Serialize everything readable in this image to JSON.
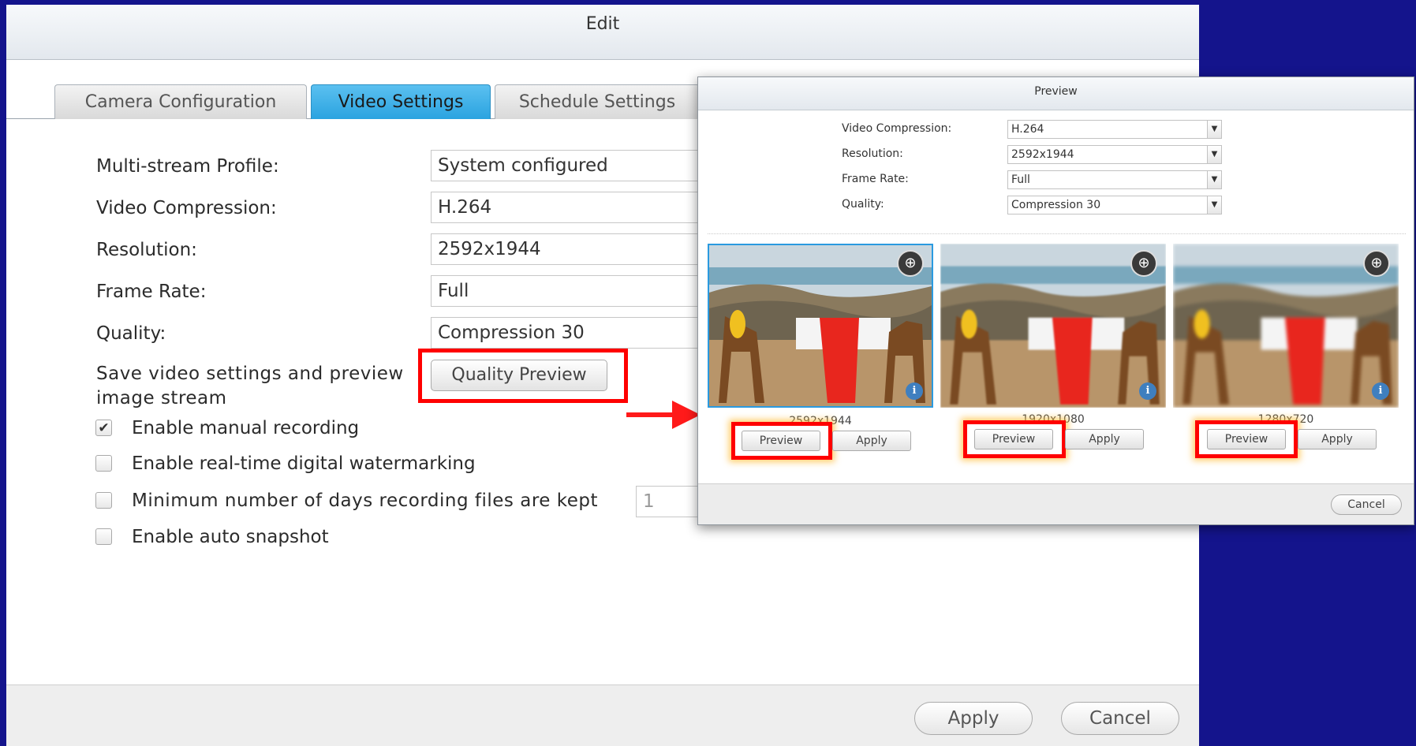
{
  "edit_dialog": {
    "title": "Edit",
    "tabs": [
      {
        "label": "Camera Configuration",
        "active": false
      },
      {
        "label": "Video Settings",
        "active": true
      },
      {
        "label": "Schedule Settings",
        "active": false
      }
    ],
    "fields": {
      "multi_stream_profile": {
        "label": "Multi-stream Profile:",
        "value": "System configured"
      },
      "video_compression": {
        "label": "Video Compression:",
        "value": "H.264"
      },
      "resolution": {
        "label": "Resolution:",
        "value": "2592x1944"
      },
      "frame_rate": {
        "label": "Frame Rate:",
        "value": "Full"
      },
      "quality": {
        "label": "Quality:",
        "value": "Compression 30"
      }
    },
    "save_preview_text_line1": "Save video settings and preview",
    "save_preview_text_line2": "image stream",
    "quality_preview_button": "Quality Preview",
    "checkboxes": [
      {
        "label": "Enable manual recording",
        "checked": true,
        "mark": "✔"
      },
      {
        "label": "Enable real-time digital watermarking",
        "checked": false,
        "mark": ""
      },
      {
        "label": "Minimum number of days recording files are kept",
        "checked": false,
        "mark": "",
        "input_value": "1"
      },
      {
        "label": "Enable auto snapshot",
        "checked": false,
        "mark": ""
      }
    ],
    "footer": {
      "apply": "Apply",
      "cancel": "Cancel"
    }
  },
  "preview_dialog": {
    "title": "Preview",
    "fields": {
      "video_compression": {
        "label": "Video Compression:",
        "value": "H.264"
      },
      "resolution": {
        "label": "Resolution:",
        "value": "2592x1944"
      },
      "frame_rate": {
        "label": "Frame Rate:",
        "value": "Full"
      },
      "quality": {
        "label": "Quality:",
        "value": "Compression 30"
      }
    },
    "thumbnails": [
      {
        "resolution": "2592x1944",
        "preview": "Preview",
        "apply": "Apply",
        "zoom_icon": "⊕",
        "info_icon": "i"
      },
      {
        "resolution": "1920x1080",
        "preview": "Preview",
        "apply": "Apply",
        "zoom_icon": "⊕",
        "info_icon": "i"
      },
      {
        "resolution": "1280x720",
        "preview": "Preview",
        "apply": "Apply",
        "zoom_icon": "⊕",
        "info_icon": "i"
      }
    ],
    "cancel": "Cancel",
    "dropdown_arrow": "▼"
  },
  "colors": {
    "background": "#14148c",
    "active_tab": "#2aa3e0",
    "highlight": "#ff0000"
  }
}
